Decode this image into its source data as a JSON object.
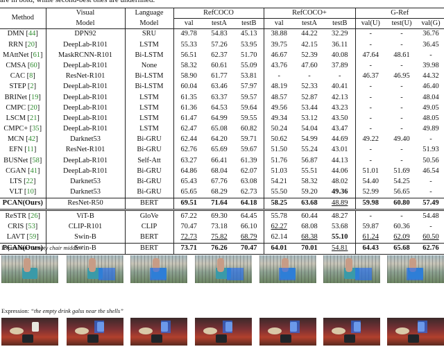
{
  "caption_fragment": "are in bold, while second-best ones are underlined.",
  "table": {
    "headers": {
      "method": "Method",
      "visual": [
        "Visual",
        "Model"
      ],
      "language": [
        "Language",
        "Model"
      ],
      "groups": [
        "RefCOCO",
        "RefCOCO+",
        "G-Ref"
      ],
      "subcols": [
        "val",
        "testA",
        "testB",
        "val",
        "testA",
        "testB",
        "val(U)",
        "test(U)",
        "val(G)"
      ]
    },
    "section1": [
      {
        "method": "DMN",
        "cite": "44",
        "visual": "DPN92",
        "lang": "SRU",
        "vals": [
          "49.78",
          "54.83",
          "45.13",
          "38.88",
          "44.22",
          "32.29",
          "-",
          "-",
          "36.76"
        ]
      },
      {
        "method": "RRN",
        "cite": "20",
        "visual": "DeepLab-R101",
        "lang": "LSTM",
        "vals": [
          "55.33",
          "57.26",
          "53.95",
          "39.75",
          "42.15",
          "36.11",
          "-",
          "-",
          "36.45"
        ]
      },
      {
        "method": "MAttNet",
        "cite": "61",
        "visual": "MaskRCNN-R101",
        "lang": "Bi-LSTM",
        "vals": [
          "56.51",
          "62.37",
          "51.70",
          "46.67",
          "52.39",
          "40.08",
          "47.64",
          "48.61",
          "-"
        ]
      },
      {
        "method": "CMSA",
        "cite": "60",
        "visual": "DeepLab-R101",
        "lang": "None",
        "vals": [
          "58.32",
          "60.61",
          "55.09",
          "43.76",
          "47.60",
          "37.89",
          "-",
          "-",
          "39.98"
        ]
      },
      {
        "method": "CAC",
        "cite": "8",
        "visual": "ResNet-R101",
        "lang": "Bi-LSTM",
        "vals": [
          "58.90",
          "61.77",
          "53.81",
          "-",
          "-",
          "-",
          "46.37",
          "46.95",
          "44.32"
        ]
      },
      {
        "method": "STEP",
        "cite": "2",
        "visual": "DeepLab-R101",
        "lang": "Bi-LSTM",
        "vals": [
          "60.04",
          "63.46",
          "57.97",
          "48.19",
          "52.33",
          "40.41",
          "-",
          "-",
          "46.40"
        ]
      },
      {
        "method": "BRINet",
        "cite": "19",
        "visual": "DeepLab-R101",
        "lang": "LSTM",
        "vals": [
          "61.35",
          "63.37",
          "59.57",
          "48.57",
          "52.87",
          "42.13",
          "-",
          "-",
          "48.04"
        ]
      },
      {
        "method": "CMPC",
        "cite": "20",
        "visual": "DeepLab-R101",
        "lang": "LSTM",
        "vals": [
          "61.36",
          "64.53",
          "59.64",
          "49.56",
          "53.44",
          "43.23",
          "-",
          "-",
          "49.05"
        ]
      },
      {
        "method": "LSCM",
        "cite": "21",
        "visual": "DeepLab-R101",
        "lang": "LSTM",
        "vals": [
          "61.47",
          "64.99",
          "59.55",
          "49.34",
          "53.12",
          "43.50",
          "-",
          "-",
          "48.05"
        ]
      },
      {
        "method": "CMPC+",
        "cite": "35",
        "visual": "DeepLab-R101",
        "lang": "LSTM",
        "vals": [
          "62.47",
          "65.08",
          "60.82",
          "50.24",
          "54.04",
          "43.47",
          "-",
          "-",
          "49.89"
        ]
      },
      {
        "method": "MCN",
        "cite": "42",
        "visual": "Darknet53",
        "lang": "Bi-GRU",
        "vals": [
          "62.44",
          "64.20",
          "59.71",
          "50.62",
          "54.99",
          "44.69",
          "49.22",
          "49.40",
          "-"
        ]
      },
      {
        "method": "EFN",
        "cite": "11",
        "visual": "ResNet-R101",
        "lang": "Bi-GRU",
        "vals": [
          "62.76",
          "65.69",
          "59.67",
          "51.50",
          "55.24",
          "43.01",
          "-",
          "-",
          "51.93"
        ]
      },
      {
        "method": "BUSNet",
        "cite": "58",
        "visual": "DeepLab-R101",
        "lang": "Self-Att",
        "vals": [
          "63.27",
          "66.41",
          "61.39",
          "51.76",
          "56.87",
          "44.13",
          "-",
          "-",
          "50.56"
        ]
      },
      {
        "method": "CGAN",
        "cite": "41",
        "visual": "DeepLab-R101",
        "lang": "Bi-GRU",
        "vals": [
          "64.86",
          "68.04",
          "62.07",
          "51.03",
          "55.51",
          "44.06",
          "51.01",
          "51.69",
          "46.54"
        ]
      },
      {
        "method": "LTS",
        "cite": "22",
        "visual": "Darknet53",
        "lang": "Bi-GRU",
        "vals": [
          "65.43",
          "67.76",
          "63.08",
          "54.21",
          "58.32",
          "48.02",
          "54.40",
          "54.25",
          "-"
        ]
      },
      {
        "method": "VLT",
        "cite": "10",
        "visual": "Darknet53",
        "lang": "Bi-GRU",
        "vals": [
          "65.65",
          "68.29",
          "62.73",
          "55.50",
          "59.20",
          "49.36",
          "52.99",
          "56.65",
          "-"
        ]
      }
    ],
    "pcan1": {
      "method": "PCAN(Ours)",
      "visual": "ResNet-R50",
      "lang": "BERT",
      "vals": [
        "69.51",
        "71.64",
        "64.18",
        "58.25",
        "63.68",
        "48.89",
        "59.98",
        "60.80",
        "57.49"
      ]
    },
    "section2": [
      {
        "method": "ReSTR",
        "cite": "26",
        "visual": "ViT-B",
        "lang": "GloVe",
        "vals": [
          "67.22",
          "69.30",
          "64.45",
          "55.78",
          "60.44",
          "48.27",
          "-",
          "-",
          "54.48"
        ]
      },
      {
        "method": "CRIS",
        "cite": "53",
        "visual": "CLIP-R101",
        "lang": "CLIP",
        "vals": [
          "70.47",
          "73.18",
          "66.10",
          "62.27",
          "68.08",
          "53.68",
          "59.87",
          "60.36",
          "-"
        ]
      },
      {
        "method": "LAVT",
        "cite": "59",
        "visual": "Swin-B",
        "lang": "BERT",
        "vals": [
          "72.73",
          "75.82",
          "68.79",
          "62.14",
          "68.38",
          "55.10",
          "61.24",
          "62.09",
          "60.50"
        ]
      }
    ],
    "pcan2": {
      "method": "PCAN(Ours)",
      "visual": "Swin-B",
      "lang": "BERT",
      "vals": [
        "73.71",
        "76.26",
        "70.47",
        "64.01",
        "70.01",
        "54.81",
        "64.43",
        "65.68",
        "62.76"
      ]
    }
  },
  "figure": {
    "expr_label": "Expression:",
    "expressions": [
      "“empty chair middle”",
      "“the empty drink galss near the shells”"
    ]
  }
}
